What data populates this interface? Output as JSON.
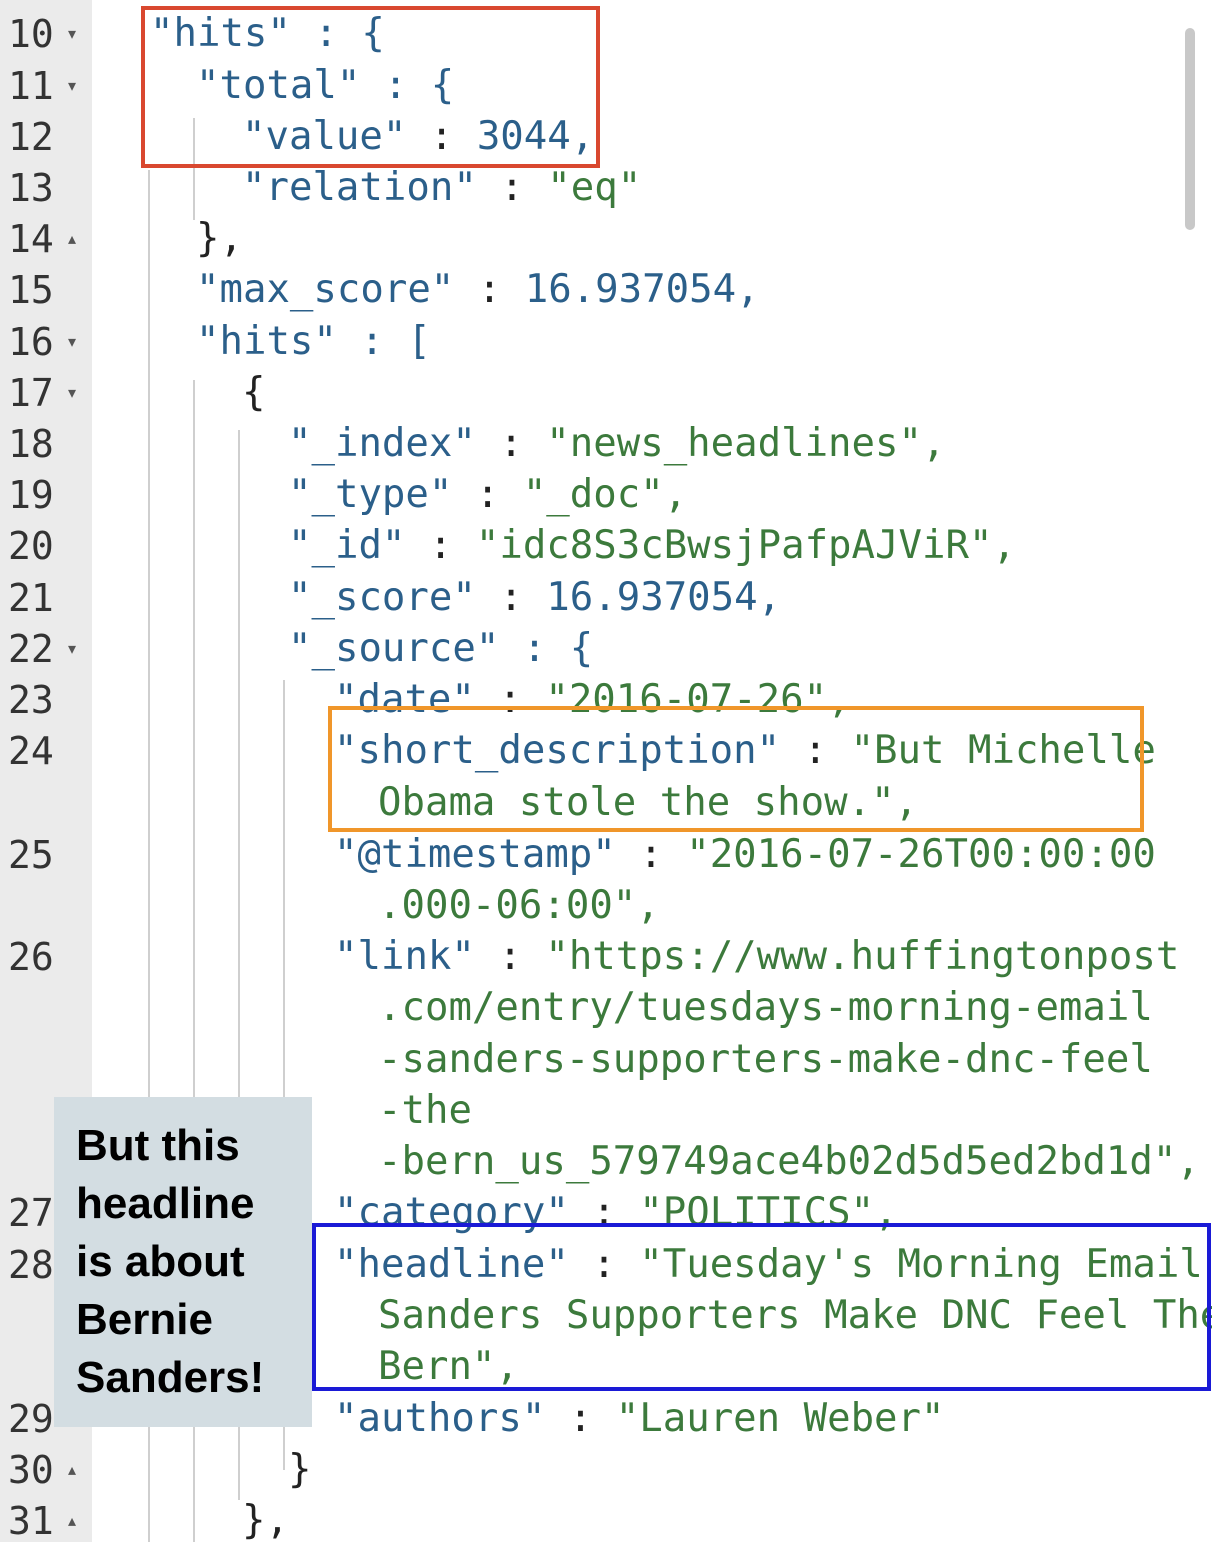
{
  "gutter": {
    "line_numbers": [
      "10",
      "11",
      "12",
      "13",
      "14",
      "15",
      "16",
      "17",
      "18",
      "19",
      "20",
      "21",
      "22",
      "23",
      "24",
      "25",
      "26",
      "27",
      "28",
      "29",
      "30",
      "31"
    ]
  },
  "code": {
    "l10": "\"hits\" : {",
    "l11": "\"total\" : {",
    "l12_key": "\"value\"",
    "l12_val": "3044,",
    "l13_key": "\"relation\"",
    "l13_val": "\"eq\"",
    "l14": "},",
    "l15_key": "\"max_score\"",
    "l15_val": "16.937054,",
    "l16": "\"hits\" : [",
    "l17": "{",
    "l18_key": "\"_index\"",
    "l18_val": "\"news_headlines\",",
    "l19_key": "\"_type\"",
    "l19_val": "\"_doc\",",
    "l20_key": "\"_id\"",
    "l20_val": "\"idc8S3cBwsjPafpAJViR\",",
    "l21_key": "\"_score\"",
    "l21_val": "16.937054,",
    "l22": "\"_source\" : {",
    "l23_key": "\"date\"",
    "l23_val": "\"2016-07-26\",",
    "l24_key": "\"short_description\"",
    "l24_val": "\"But Michelle",
    "l24_cont": "Obama stole the show.\",",
    "l25_key": "\"@timestamp\"",
    "l25_val": "\"2016-07-26T00:00:00",
    "l25_cont": ".000-06:00\",",
    "l26_key": "\"link\"",
    "l26_val": "\"https://www.huffingtonpost",
    "l26_c1": ".com/entry/tuesdays-morning-email",
    "l26_c2": "-sanders-supporters-make-dnc-feel",
    "l26_c3": "-the",
    "l26_c4": "-bern_us_579749ace4b02d5d5ed2bd1d\",",
    "l27_key": "\"category\"",
    "l27_val": "\"POLITICS\",",
    "l28_key": "\"headline\"",
    "l28_val": "\"Tuesday's Morning Email:",
    "l28_c1": "Sanders Supporters Make DNC Feel The",
    "l28_c2": "Bern\",",
    "l29_key": "\"authors\"",
    "l29_val": "\"Lauren Weber\"",
    "l30": "}",
    "l31": "},"
  },
  "callout": {
    "text": "But this\nheadline\nis about\nBernie\nSanders!"
  },
  "colors": {
    "box_red": "#d9482f",
    "box_orange": "#f0962a",
    "box_blue": "#1a1ad6",
    "callout_bg": "#d3dde2"
  }
}
